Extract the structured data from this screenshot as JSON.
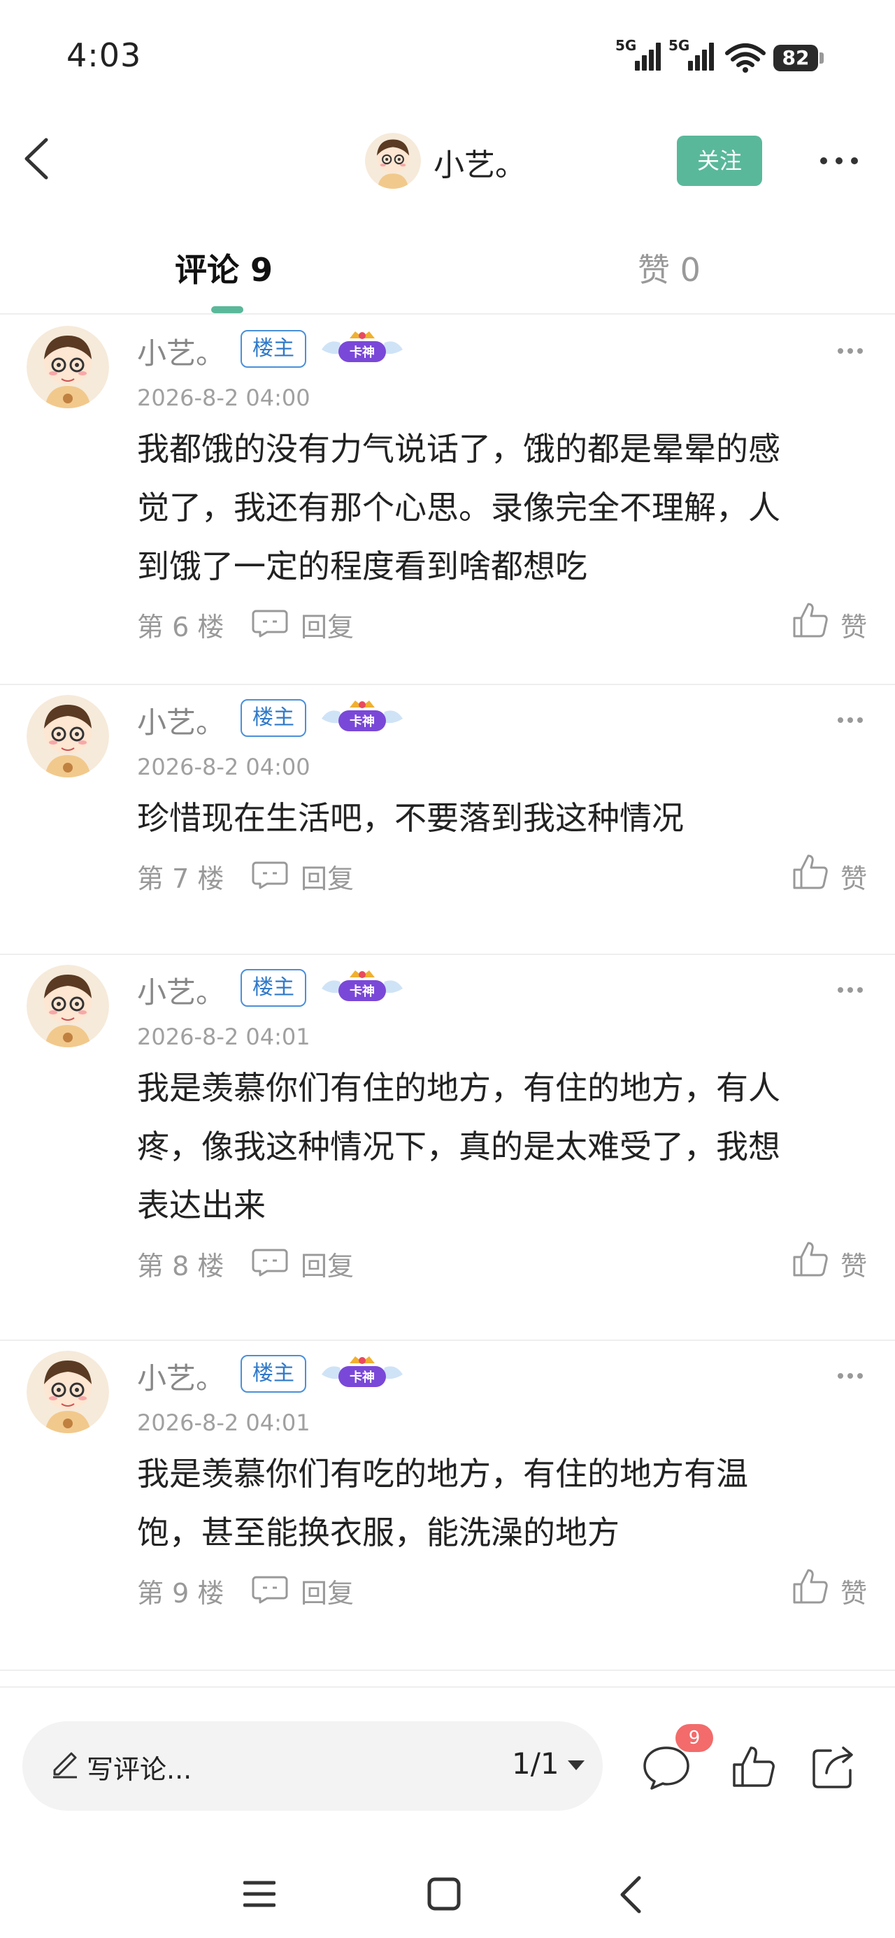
{
  "status_bar": {
    "time": "4:03",
    "signal1_label": "5G",
    "signal2_label": "5G",
    "battery": "82"
  },
  "header": {
    "title": "小艺。",
    "follow_label": "关注"
  },
  "tabs": {
    "comments_label": "评论 9",
    "likes_label": "赞 0"
  },
  "comments": [
    {
      "author": "小艺。",
      "owner_badge": "楼主",
      "card_badge": "卡神",
      "time": "2026-8-2 04:00",
      "lines": [
        "我都饿的没有力气说话了，饿的都是晕晕的感",
        "觉了，我还有那个心思。录像完全不理解，人",
        "到饿了一定的程度看到啥都想吃"
      ],
      "floor": "第 6 楼",
      "reply_label": "回复",
      "like_label": "赞"
    },
    {
      "author": "小艺。",
      "owner_badge": "楼主",
      "card_badge": "卡神",
      "time": "2026-8-2 04:00",
      "lines": [
        "珍惜现在生活吧，不要落到我这种情况"
      ],
      "floor": "第 7 楼",
      "reply_label": "回复",
      "like_label": "赞"
    },
    {
      "author": "小艺。",
      "owner_badge": "楼主",
      "card_badge": "卡神",
      "time": "2026-8-2 04:01",
      "lines": [
        "我是羡慕你们有住的地方，有住的地方，有人",
        "疼，像我这种情况下，真的是太难受了，我想",
        "表达出来"
      ],
      "floor": "第 8 楼",
      "reply_label": "回复",
      "like_label": "赞"
    },
    {
      "author": "小艺。",
      "owner_badge": "楼主",
      "card_badge": "卡神",
      "time": "2026-8-2 04:01",
      "lines": [
        "我是羡慕你们有吃的地方，有住的地方有温",
        "饱，甚至能换衣服，能洗澡的地方"
      ],
      "floor": "第 9 楼",
      "reply_label": "回复",
      "like_label": "赞"
    }
  ],
  "bottom_bar": {
    "input_placeholder": "写评论...",
    "page": "1/1",
    "comment_count": "9"
  },
  "colors": {
    "accent": "#5ab89a",
    "badge_blue": "#2f79c9",
    "notification_red": "#f36b6b"
  }
}
